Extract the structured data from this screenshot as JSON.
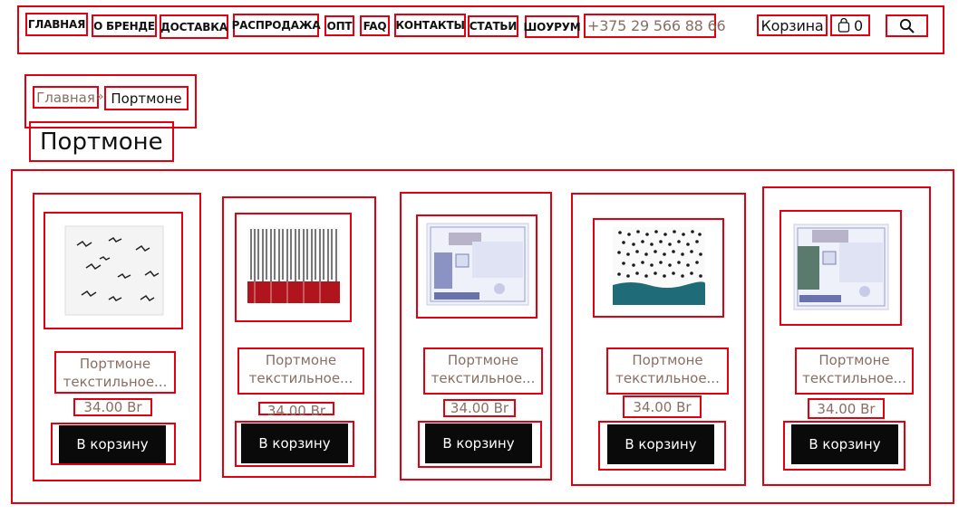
{
  "nav": {
    "items": [
      "ГЛАВНАЯ",
      "О БРЕНДЕ",
      "ДОСТАВКА",
      "РАСПРОДАЖА",
      "ОПТ",
      "FAQ",
      "КОНТАКТЫ",
      "СТАТЬИ",
      "ШОУРУМ"
    ],
    "phone": "+375 29 566 88 66",
    "cart_label": "Корзина",
    "cart_count": "0",
    "search_icon": "search-icon"
  },
  "breadcrumb": {
    "home": "Главная",
    "separator": "»",
    "current": "Портмоне"
  },
  "page_title": "Портмоне",
  "products": [
    {
      "name": "Портмоне текстильное...",
      "price": "34.00 Br",
      "button": "В корзину",
      "image": "white wallet with birds print"
    },
    {
      "name": "Портмоне текстильное...",
      "price": "34.00 Br",
      "button": "В корзину",
      "image": "barcode print wallet with red bottom"
    },
    {
      "name": "Портмоне текстильное...",
      "price": "34.00 Br",
      "button": "В корзину",
      "image": "banknote print wallet"
    },
    {
      "name": "Портмоне текстильное...",
      "price": "34.00 Br",
      "button": "В корзину",
      "image": "dots print wallet with teal bottom"
    },
    {
      "name": "Портмоне текстильное...",
      "price": "34.00 Br",
      "button": "В корзину",
      "image": "banknote print wallet"
    }
  ],
  "colors": {
    "accent": "#8a6e63",
    "button_bg": "#0a0a0a",
    "highlight": "#e0000f"
  }
}
